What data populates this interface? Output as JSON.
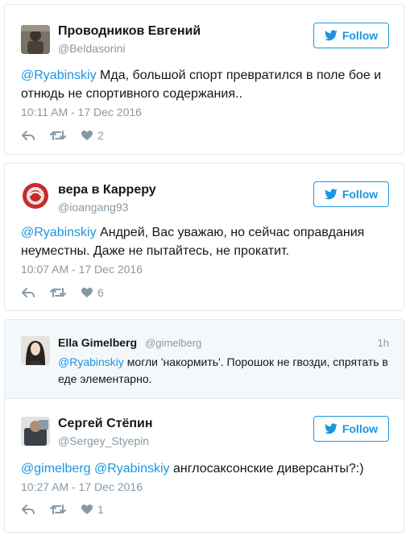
{
  "colors": {
    "accent": "#1b95e0",
    "muted": "#8899a6",
    "border": "#e1e8ed",
    "quote_bg": "#f5f8fa"
  },
  "follow_label": "Follow",
  "tweets": [
    {
      "name": "Проводников Евгений",
      "handle": "@Beldasorini",
      "mention": "@Ryabinskiy",
      "text": " Мда, большой спорт превратился в поле бое и отнюдь не спортивного содержания..",
      "time": "10:11 AM - 17 Dec 2016",
      "likes": "2"
    },
    {
      "name": "вера в Карреру",
      "handle": "@ioangang93",
      "mention": "@Ryabinskiy",
      "text": " Андрей, Вас уважаю, но сейчас оправдания неуместны. Даже не пытайтесь, не прокатит.",
      "time": "10:07 AM - 17 Dec 2016",
      "likes": "6"
    }
  ],
  "quote": {
    "name": "Ella Gimelberg",
    "handle": "@gimelberg",
    "time": "1h",
    "mention": "@Ryabinskiy",
    "text": " могли 'накормить'. Порошок не гвозди, спрятать в еде элементарно."
  },
  "reply": {
    "name": "Сергей Стёпин",
    "handle": "@Sergey_Styepin",
    "mention1": "@gimelberg",
    "mention2": "@Ryabinskiy",
    "text": " англосаксонские диверсанты?:)",
    "time": "10:27 AM - 17 Dec 2016",
    "likes": "1"
  }
}
